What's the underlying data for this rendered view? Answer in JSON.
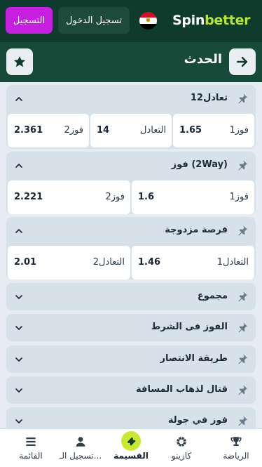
{
  "header": {
    "logo_spin": "Spin",
    "logo_better": "better",
    "flag_icon": "egypt-flag-icon",
    "login_label": "تسجيل الدخول",
    "register_label": "التسجيل"
  },
  "titlebar": {
    "title": "الحدث",
    "back_icon": "arrow-right-icon",
    "star_icon": "star-icon"
  },
  "markets": [
    {
      "title": "1تعادل2",
      "expanded": true,
      "odds": [
        {
          "label": "فوز1",
          "value": "1.65"
        },
        {
          "label": "التعادل",
          "value": "14"
        },
        {
          "label": "فوز2",
          "value": "2.361"
        }
      ]
    },
    {
      "title": "فوز (2Way)",
      "expanded": true,
      "odds": [
        {
          "label": "فوز1",
          "value": "1.6"
        },
        {
          "label": "فوز2",
          "value": "2.221"
        }
      ]
    },
    {
      "title": "فرصة مزدوجة",
      "expanded": true,
      "odds": [
        {
          "label": "1التعادل",
          "value": "1.46"
        },
        {
          "label": "2التعادل",
          "value": "2.01"
        }
      ]
    },
    {
      "title": "مجموع",
      "expanded": false
    },
    {
      "title": "الفوز فى الشرط",
      "expanded": false
    },
    {
      "title": "طريقة الانتصار",
      "expanded": false
    },
    {
      "title": "قتال لذهاب المسافة",
      "expanded": false
    },
    {
      "title": "فوز في جولة",
      "expanded": false
    }
  ],
  "bottom_nav": [
    {
      "label": "الرياضة",
      "icon": "trophy-icon"
    },
    {
      "label": "كازينو",
      "icon": "casino-chip-icon"
    },
    {
      "label": "القسيمة",
      "icon": "ticket-icon",
      "active": true
    },
    {
      "label": "تسجيل الـ...",
      "icon": "user-icon"
    },
    {
      "label": "القائمة",
      "icon": "menu-icon"
    }
  ],
  "colors": {
    "header_bg": "#0f3b2c",
    "titlebar_bg": "#184a39",
    "brand_green": "#b4e435",
    "register_purple": "#c61fe0",
    "coupon_accent": "#c9e832"
  }
}
